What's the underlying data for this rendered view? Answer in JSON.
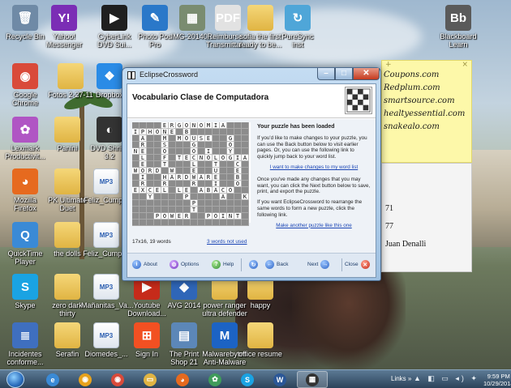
{
  "desktop": {
    "icons": [
      {
        "id": "recycle",
        "label": "Recycle Bin",
        "glyph": "🗑"
      },
      {
        "id": "yahoo",
        "label": "Yahoo!\nMessenger",
        "glyph": "Y!"
      },
      {
        "id": "cyberlink",
        "label": "CyberLink\nDVD Sui...",
        "glyph": "▶"
      },
      {
        "id": "photopos",
        "label": "Photo Pos\nPro",
        "glyph": "✎"
      },
      {
        "id": "img2014",
        "label": "IMG-20140...",
        "glyph": "▦"
      },
      {
        "id": "reimburse",
        "label": "Reimburse...\nTransmittal ...",
        "glyph": "PDF"
      },
      {
        "id": "sofia",
        "label": "sofia the first\nready to be...",
        "glyph": ""
      },
      {
        "id": "puresync",
        "label": "PureSync\ninst",
        "glyph": "↻"
      },
      {
        "id": "blackboard",
        "label": "Blackboard\nLearn",
        "glyph": "Bb"
      },
      {
        "id": "chrome",
        "label": "Google\nChrome",
        "glyph": "◉"
      },
      {
        "id": "fotos",
        "label": "Fotos 2-27-11",
        "glyph": ""
      },
      {
        "id": "dropbox",
        "label": "Dropbox",
        "glyph": "❖"
      },
      {
        "id": "lexmark",
        "label": "Lexmark\nProductivit...",
        "glyph": "✿"
      },
      {
        "id": "panini",
        "label": "Panini",
        "glyph": ""
      },
      {
        "id": "dvdshrink",
        "label": "DVD Shrink\n3.2",
        "glyph": "◐"
      },
      {
        "id": "firefox",
        "label": "Mozilla\nFirefox",
        "glyph": "◕"
      },
      {
        "id": "pkultimate",
        "label": "PK Ultimate\nDuet",
        "glyph": ""
      },
      {
        "id": "feliz1",
        "label": "Feliz_Cump...",
        "glyph": "MP3"
      },
      {
        "id": "quicktime",
        "label": "QuickTime\nPlayer",
        "glyph": "Q"
      },
      {
        "id": "thedoll",
        "label": "the dolls",
        "glyph": ""
      },
      {
        "id": "feliz2",
        "label": "Feliz_Cumpl...",
        "glyph": "MP3"
      },
      {
        "id": "skype",
        "label": "Skype",
        "glyph": "S"
      },
      {
        "id": "zerodark",
        "label": "zero dark\nthirty",
        "glyph": ""
      },
      {
        "id": "mananita",
        "label": "Mañanitas_Va...",
        "glyph": "MP3"
      },
      {
        "id": "youtube",
        "label": "Youtube\nDownload...",
        "glyph": "▶"
      },
      {
        "id": "avg",
        "label": "AVG 2014",
        "glyph": "◆"
      },
      {
        "id": "powerranger",
        "label": "power ranger\nultra defender",
        "glyph": ""
      },
      {
        "id": "happy",
        "label": "happy",
        "glyph": ""
      },
      {
        "id": "incidentes",
        "label": "Incidentes\nconforme...",
        "glyph": "≣"
      },
      {
        "id": "serafin",
        "label": "Serafin",
        "glyph": ""
      },
      {
        "id": "diomedes",
        "label": "Diomedes_...",
        "glyph": "MP3"
      },
      {
        "id": "signin",
        "label": "Sign In",
        "glyph": "⊞"
      },
      {
        "id": "printshop",
        "label": "The Print\nShop 21",
        "glyph": "▤"
      },
      {
        "id": "malwarebytes",
        "label": "Malwarebytes\nAnti-Malware",
        "glyph": "M"
      },
      {
        "id": "officeresume",
        "label": "office resume",
        "glyph": ""
      }
    ]
  },
  "sticky": {
    "lines": [
      "Coupons.com",
      "Redplum.com",
      "smartsource.com",
      "healtyessential.com",
      "snakealo.com"
    ],
    "plus": "+",
    "close": "×"
  },
  "background_window": {
    "lines": [
      "71",
      "77",
      "Juan Denalli"
    ]
  },
  "window": {
    "title": "EclipseCrossword",
    "heading": "Vocabulario Clase de Computadora",
    "info_title": "Your puzzle has been loaded",
    "p1": "If you'd like to make changes to your puzzle, you can use the Back button below to visit earlier pages. Or, you can use the following link to quickly jump back to your word list.",
    "link1": "I want to make changes to my word list",
    "p2": "Once you've made any changes that you may want, you can click the Next button below to save, print, and export the puzzle.",
    "p3": "If you want EclipseCrossword to rearrange the same words to form a new puzzle, click the following link.",
    "link2": "Make another puzzle like this one",
    "stats": "17x16, 19 words",
    "unused_link": "3 words not used",
    "footer": {
      "about": "About",
      "options": "Options",
      "help": "Help",
      "back": "Back",
      "next": "Next",
      "close": "Close"
    }
  },
  "crossword_rows": [
    "####ERGONOMIA####",
    "IPHONE#B########",
    "#A##M#MOUSE##G##",
    "#R##S###G####O##",
    "NE##O###O#I##Y##F",
    "#L##F#TECNOLOGIA",
    "#E##T###L##T##C#",
    "WORD#W##E##U##E#",
    "#I##HARDWARE##B#",
    "#R##R###R##I##O#",
    "EXCEL#LE#ABACO##",
    "##Y####P####A##K",
    "########P#######",
    "########T#######",
    "###POWER##POINT#",
    "#################"
  ],
  "taskbar": {
    "items": [
      "ie",
      "chrome-alt",
      "chrome",
      "explorer",
      "firefox",
      "photos",
      "skype",
      "word",
      "eclipse"
    ],
    "links": "Links",
    "chevron": "»",
    "time": "9:59 PM",
    "date": "10/29/2014"
  },
  "colors": {
    "accent": "#1b46b5",
    "title_bar": "#c4dcf2",
    "close_red": "#c53a1f",
    "sticky_yellow": "#fdf8a9"
  }
}
